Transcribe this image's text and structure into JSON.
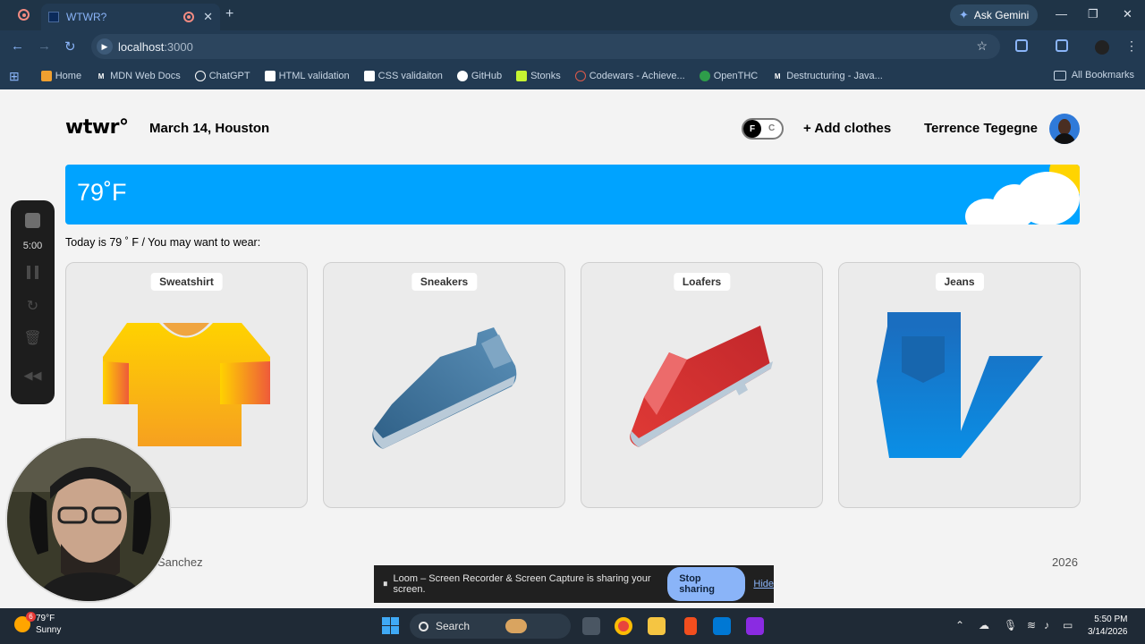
{
  "browser": {
    "tab_title": "WTWR?",
    "address": {
      "host": "localhost",
      "port": ":3000"
    },
    "gemini_label": "Ask Gemini",
    "bookmarks": [
      "Home",
      "MDN Web Docs",
      "ChatGPT",
      "HTML validation",
      "CSS validaiton",
      "GitHub",
      "Stonks",
      "Codewars - Achieve...",
      "OpenTHC",
      "Destructuring - Java..."
    ],
    "all_bookmarks": "All Bookmarks"
  },
  "header": {
    "logo": "wtwr°",
    "date_location": "March 14, Houston",
    "toggle": {
      "on": "F",
      "off": "C"
    },
    "add_clothes": "+ Add clothes",
    "username": "Terrence Tegegne"
  },
  "weather": {
    "temp": "79˚F"
  },
  "main": {
    "today_text": "Today is 79 ˚ F / You may want to wear:",
    "cards": [
      {
        "name": "Sweatshirt",
        "icon": "sweatshirt-icon"
      },
      {
        "name": "Sneakers",
        "icon": "sneaker-icon"
      },
      {
        "name": "Loafers",
        "icon": "loafer-icon"
      },
      {
        "name": "Jeans",
        "icon": "jeans-icon"
      }
    ]
  },
  "footer": {
    "left": "Sanchez",
    "right": "2026"
  },
  "loom": {
    "timer": "5:00",
    "banner_text": "Loom – Screen Recorder & Screen Capture is sharing your screen.",
    "stop_label": "Stop sharing",
    "hide_label": "Hide"
  },
  "taskbar": {
    "weather_temp": "79°F",
    "weather_desc": "Sunny",
    "weather_badge": "6",
    "search_label": "Search",
    "time": "5:50 PM",
    "date": "3/14/2026"
  }
}
